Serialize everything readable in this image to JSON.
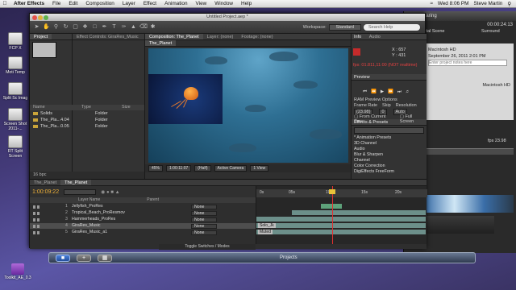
{
  "menubar": {
    "app": "After Effects",
    "items": [
      "File",
      "Edit",
      "Composition",
      "Layer",
      "Effect",
      "Animation",
      "View",
      "Window",
      "Help"
    ],
    "clock": "Wed 8:06 PM",
    "user": "Steve Martin"
  },
  "desktop": {
    "icons": [
      "FCP X",
      "Moti Temp",
      "Split Sc Imag",
      "Screen Shot 2011-...",
      "RT Split Screen"
    ],
    "toolkit_label": "Toolkit_AE_0.3"
  },
  "fcp": {
    "tabs": [
      "Sharing"
    ],
    "timecode": "00:00:24:13",
    "scene": "Ital Scene",
    "surround": "Surround",
    "hd1": "Macintosh HD",
    "date": "September 26, 2011 2:01 PM",
    "notes_placeholder": "Enter project notes here",
    "hd2": "Macintosh HD",
    "fps": "fps 23.98",
    "dock_label": "Projects"
  },
  "ae": {
    "window_title": "Untitled Project.aep *",
    "pixel_cut": "Pixel Cut Pro",
    "workspace_label": "Workspace:",
    "workspace_value": "Standard",
    "search_placeholder": "Search Help",
    "project_tab": "Project",
    "effect_controls_tab": "Effect Controls: GiraRes_Music",
    "project_columns": [
      "Name",
      "Type",
      "Size"
    ],
    "project_items": [
      {
        "name": "Solids",
        "type": "Folder"
      },
      {
        "name": "The_Pla...4.04",
        "type": "Folder"
      },
      {
        "name": "The_Pla...0.05",
        "type": "Folder"
      }
    ],
    "project_foot": "16 bpc",
    "comp_tab": "Composition: The_Planet",
    "layer_tab": "Layer: (none)",
    "footage_tab": "Footage: (none)",
    "comp_subtab": "The_Planet",
    "comp_footer": [
      "45%",
      "1:00:11:07",
      "(Half)",
      "Active Camera",
      "1 View"
    ],
    "info": {
      "title": "Info",
      "audio_tab": "Audio",
      "x": "X : 657",
      "y": "Y : 431",
      "status": "fps: 01.811,11:00 (NOT realtime)"
    },
    "preview": {
      "title": "Preview",
      "ram_options": "RAM Preview Options",
      "frame_rate": "Frame Rate",
      "skip": "Skip",
      "resolution": "Resolution",
      "fr_val": "(23.98)",
      "skip_val": "0",
      "res_val": "Auto",
      "from_current": "From Current Time",
      "full_screen": "Full Screen"
    },
    "effects": {
      "title": "Effects & Presets",
      "items": [
        "* Animation Presets",
        "3D Channel",
        "Audio",
        "Blur & Sharpen",
        "Channel",
        "Color Correction",
        "DigiEffects FreeForm"
      ]
    },
    "timeline": {
      "tabs": [
        "The_Planet",
        "The_Planet"
      ],
      "timecode": "1:00:09:22",
      "layer_header": [
        "Layer Name",
        "Parent"
      ],
      "layers": [
        {
          "num": "1",
          "name": "Jellyfish_ProRes",
          "parent": "None"
        },
        {
          "num": "2",
          "name": "Tropical_Beach_ProResmov",
          "parent": "None"
        },
        {
          "num": "3",
          "name": "Hammerheads_ProRes",
          "parent": "None"
        },
        {
          "num": "4",
          "name": "GiraRes_Music",
          "parent": "None"
        },
        {
          "num": "5",
          "name": "GiraRes_Music_a1",
          "parent": "None"
        }
      ],
      "ruler": [
        "0s",
        "05s",
        "10s",
        "15s",
        "20s"
      ],
      "footer": "Toggle Switches / Modes",
      "clip_labels": [
        "Solo_Jk",
        "Muted"
      ]
    }
  }
}
